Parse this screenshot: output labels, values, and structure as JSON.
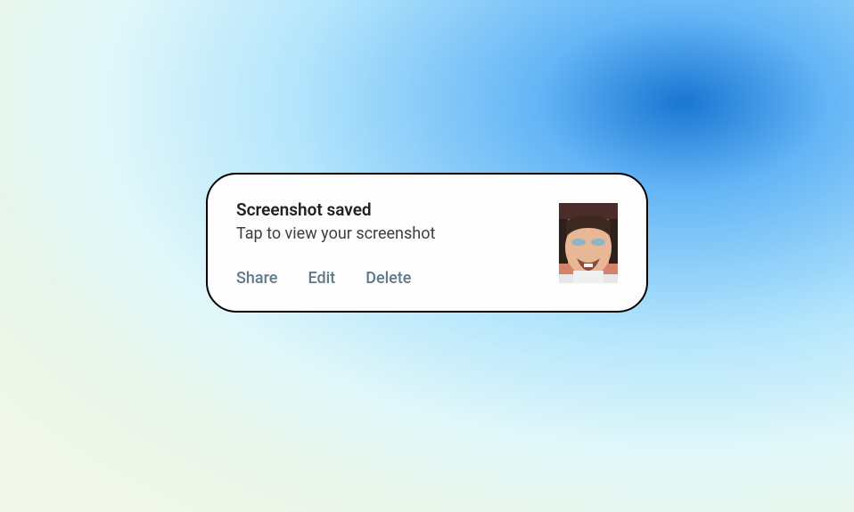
{
  "notification": {
    "title": "Screenshot saved",
    "subtitle": "Tap to view your screenshot",
    "actions": {
      "share": "Share",
      "edit": "Edit",
      "delete": "Delete"
    },
    "thumbnail_alt": "screenshot-thumbnail"
  },
  "colors": {
    "action_text": "#5f7a8a",
    "title_text": "#202124",
    "subtitle_text": "#3c4043"
  }
}
